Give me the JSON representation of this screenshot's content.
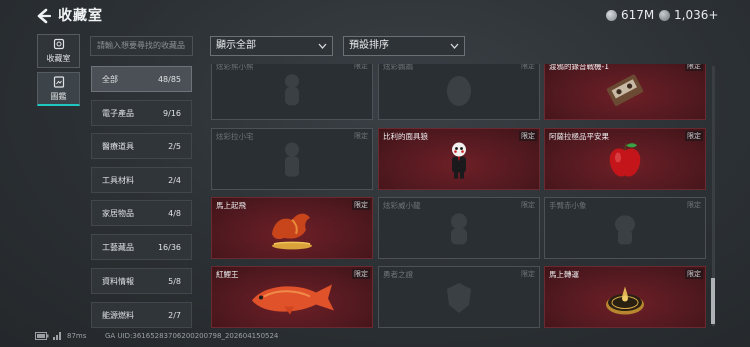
{
  "header": {
    "title": "收藏室",
    "currency": [
      "617M",
      "1,036+"
    ]
  },
  "nav": [
    {
      "label": "收藏室",
      "icon": "safe-icon",
      "active": false
    },
    {
      "label": "圖鑑",
      "icon": "catalog-icon",
      "active": true
    }
  ],
  "search": {
    "placeholder": "請輸入想要尋找的收藏品"
  },
  "filters": {
    "display": "顯示全部",
    "sort": "預設排序"
  },
  "categories": [
    {
      "label": "全部",
      "count": "48/85",
      "active": true
    },
    {
      "label": "電子產品",
      "count": "9/16"
    },
    {
      "label": "醫療道具",
      "count": "2/5"
    },
    {
      "label": "工具材料",
      "count": "2/4"
    },
    {
      "label": "家居物品",
      "count": "4/8"
    },
    {
      "label": "工藝藏品",
      "count": "16/36"
    },
    {
      "label": "資料情報",
      "count": "5/8"
    },
    {
      "label": "能源燃料",
      "count": "2/7"
    }
  ],
  "items": [
    {
      "name": "炫彩熊小熊",
      "tag": "限定",
      "owned": false,
      "art": "bear-icon"
    },
    {
      "name": "炫彩鸚鵡",
      "tag": "限定",
      "owned": false,
      "art": "egg-icon"
    },
    {
      "name": "渡鴉的錄音戰機-1",
      "tag": "限定",
      "owned": true,
      "art": "cassette-icon"
    },
    {
      "name": "炫彩拉小宅",
      "tag": "限定",
      "owned": false,
      "art": "figure-icon"
    },
    {
      "name": "比利的面具狼",
      "tag": "限定",
      "owned": true,
      "art": "puppet-icon"
    },
    {
      "name": "阿薩拉極品平安果",
      "tag": "限定",
      "owned": true,
      "art": "apple-icon"
    },
    {
      "name": "馬上起飛",
      "tag": "限定",
      "owned": true,
      "art": "horse-icon"
    },
    {
      "name": "炫彩威小龍",
      "tag": "限定",
      "owned": false,
      "art": "dragon-icon"
    },
    {
      "name": "手臂赤小象",
      "tag": "限定",
      "owned": false,
      "art": "elephant-icon"
    },
    {
      "name": "紅鯉王",
      "tag": "限定",
      "owned": true,
      "art": "carp-icon"
    },
    {
      "name": "勇者之證",
      "tag": "限定",
      "owned": false,
      "art": "badge-icon"
    },
    {
      "name": "馬上轉運",
      "tag": "限定",
      "owned": true,
      "art": "compass-icon"
    }
  ],
  "footer": {
    "ping": "87ms",
    "uid": "GA UID:36165283706200200798_202604150524"
  },
  "colors": {
    "accent": "#1fc7c0",
    "owned_bg": "#521920"
  }
}
